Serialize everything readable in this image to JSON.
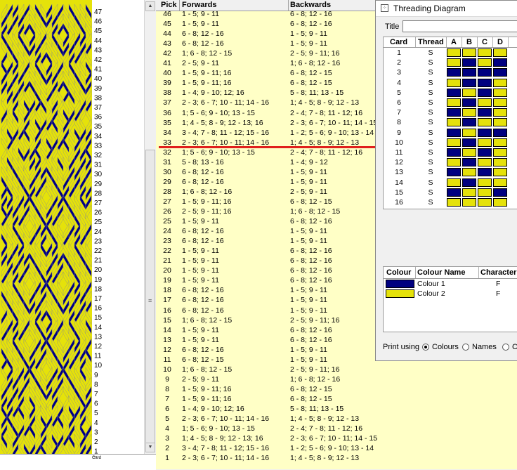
{
  "weave": {
    "colors": {
      "dark": "#000080",
      "light": "#e5e20a",
      "grid": "#8c8c8c"
    },
    "pick_labels": [
      "47",
      "46",
      "45",
      "44",
      "43",
      "42",
      "41",
      "40",
      "39",
      "38",
      "37",
      "36",
      "35",
      "34",
      "33",
      "32",
      "31",
      "30",
      "29",
      "28",
      "27",
      "26",
      "25",
      "24",
      "23",
      "22",
      "21",
      "20",
      "19",
      "18",
      "17",
      "16",
      "15",
      "14",
      "13",
      "12",
      "11",
      "10",
      "9",
      "8",
      "7",
      "6",
      "5",
      "4",
      "3",
      "2",
      "1"
    ],
    "card_label": "Card",
    "card_arrow": "←"
  },
  "scrollbar": {
    "up": "▲",
    "down": "▼",
    "grip": "≡"
  },
  "pick_table": {
    "headers": {
      "pick": "Pick",
      "forwards": "Forwards",
      "backwards": "Backwards"
    },
    "rows": [
      {
        "pick": "46",
        "fwd": "1 - 5; 9 - 11",
        "bwd": "6 - 8; 12 - 16"
      },
      {
        "pick": "45",
        "fwd": "1 - 5; 9 - 11",
        "bwd": "6 - 8; 12 - 16"
      },
      {
        "pick": "44",
        "fwd": "6 - 8; 12 - 16",
        "bwd": "1 - 5; 9 - 11"
      },
      {
        "pick": "43",
        "fwd": "6 - 8; 12 - 16",
        "bwd": "1 - 5; 9 - 11"
      },
      {
        "pick": "42",
        "fwd": "1; 6 - 8; 12 - 15",
        "bwd": "2 - 5; 9 - 11; 16"
      },
      {
        "pick": "41",
        "fwd": "2 - 5; 9 - 11",
        "bwd": "1; 6 - 8; 12 - 16"
      },
      {
        "pick": "40",
        "fwd": "1 - 5; 9 - 11; 16",
        "bwd": "6 - 8; 12 - 15"
      },
      {
        "pick": "39",
        "fwd": "1 - 5; 9 - 11; 16",
        "bwd": "6 - 8; 12 - 15"
      },
      {
        "pick": "38",
        "fwd": "1 - 4; 9 - 10; 12; 16",
        "bwd": "5 - 8; 11; 13 - 15"
      },
      {
        "pick": "37",
        "fwd": "2 - 3; 6 - 7; 10 - 11; 14 - 16",
        "bwd": "1; 4 - 5; 8 - 9; 12 - 13"
      },
      {
        "pick": "36",
        "fwd": "1; 5 - 6; 9 - 10; 13 - 15",
        "bwd": "2 - 4; 7 - 8; 11 - 12; 16"
      },
      {
        "pick": "35",
        "fwd": "1; 4 - 5; 8 - 9; 12 - 13; 16",
        "bwd": "2 - 3; 6 - 7; 10 - 11; 14 - 15"
      },
      {
        "pick": "34",
        "fwd": "3 - 4; 7 - 8; 11 - 12; 15 - 16",
        "bwd": "1 - 2; 5 - 6; 9 - 10; 13 - 14"
      },
      {
        "pick": "33",
        "fwd": "2 - 3; 6 - 7; 10 - 11; 14 - 16",
        "bwd": "1; 4 - 5; 8 - 9; 12 - 13"
      },
      {
        "pick": "32",
        "fwd": "1; 5 - 6; 9 - 10; 13 - 15",
        "bwd": "2 - 4; 7 - 8; 11 - 12; 16"
      },
      {
        "pick": "31",
        "fwd": "5 - 8; 13 - 16",
        "bwd": "1 - 4; 9 - 12"
      },
      {
        "pick": "30",
        "fwd": "6 - 8; 12 - 16",
        "bwd": "1 - 5; 9 - 11"
      },
      {
        "pick": "29",
        "fwd": "6 - 8; 12 - 16",
        "bwd": "1 - 5; 9 - 11"
      },
      {
        "pick": "28",
        "fwd": "1; 6 - 8; 12 - 16",
        "bwd": "2 - 5; 9 - 11"
      },
      {
        "pick": "27",
        "fwd": "1 - 5; 9 - 11; 16",
        "bwd": "6 - 8; 12 - 15"
      },
      {
        "pick": "26",
        "fwd": "2 - 5; 9 - 11; 16",
        "bwd": "1; 6 - 8; 12 - 15"
      },
      {
        "pick": "25",
        "fwd": "1 - 5; 9 - 11",
        "bwd": "6 - 8; 12 - 16"
      },
      {
        "pick": "24",
        "fwd": "6 - 8; 12 - 16",
        "bwd": "1 - 5; 9 - 11"
      },
      {
        "pick": "23",
        "fwd": "6 - 8; 12 - 16",
        "bwd": "1 - 5; 9 - 11"
      },
      {
        "pick": "22",
        "fwd": "1 - 5; 9 - 11",
        "bwd": "6 - 8; 12 - 16"
      },
      {
        "pick": "21",
        "fwd": "1 - 5; 9 - 11",
        "bwd": "6 - 8; 12 - 16"
      },
      {
        "pick": "20",
        "fwd": "1 - 5; 9 - 11",
        "bwd": "6 - 8; 12 - 16"
      },
      {
        "pick": "19",
        "fwd": "1 - 5; 9 - 11",
        "bwd": "6 - 8; 12 - 16"
      },
      {
        "pick": "18",
        "fwd": "6 - 8; 12 - 16",
        "bwd": "1 - 5; 9 - 11"
      },
      {
        "pick": "17",
        "fwd": "6 - 8; 12 - 16",
        "bwd": "1 - 5; 9 - 11"
      },
      {
        "pick": "16",
        "fwd": "6 - 8; 12 - 16",
        "bwd": "1 - 5; 9 - 11"
      },
      {
        "pick": "15",
        "fwd": "1; 6 - 8; 12 - 15",
        "bwd": "2 - 5; 9 - 11; 16"
      },
      {
        "pick": "14",
        "fwd": "1 - 5; 9 - 11",
        "bwd": "6 - 8; 12 - 16"
      },
      {
        "pick": "13",
        "fwd": "1 - 5; 9 - 11",
        "bwd": "6 - 8; 12 - 16"
      },
      {
        "pick": "12",
        "fwd": "6 - 8; 12 - 16",
        "bwd": "1 - 5; 9 - 11"
      },
      {
        "pick": "11",
        "fwd": "6 - 8; 12 - 15",
        "bwd": "1 - 5; 9 - 11"
      },
      {
        "pick": "10",
        "fwd": "1; 6 - 8; 12 - 15",
        "bwd": "2 - 5; 9 - 11; 16"
      },
      {
        "pick": "9",
        "fwd": "2 - 5; 9 - 11",
        "bwd": "1; 6 - 8; 12 - 16"
      },
      {
        "pick": "8",
        "fwd": "1 - 5; 9 - 11; 16",
        "bwd": "6 - 8; 12 - 15"
      },
      {
        "pick": "7",
        "fwd": "1 - 5; 9 - 11; 16",
        "bwd": "6 - 8; 12 - 15"
      },
      {
        "pick": "6",
        "fwd": "1 - 4; 9 - 10; 12; 16",
        "bwd": "5 - 8; 11; 13 - 15"
      },
      {
        "pick": "5",
        "fwd": "2 - 3; 6 - 7; 10 - 11; 14 - 16",
        "bwd": "1; 4 - 5; 8 - 9; 12 - 13"
      },
      {
        "pick": "4",
        "fwd": "1; 5 - 6; 9 - 10; 13 - 15",
        "bwd": "2 - 4; 7 - 8; 11 - 12; 16"
      },
      {
        "pick": "3",
        "fwd": "1; 4 - 5; 8 - 9; 12 - 13; 16",
        "bwd": "2 - 3; 6 - 7; 10 - 11; 14 - 15"
      },
      {
        "pick": "2",
        "fwd": "3 - 4; 7 - 8; 11 - 12; 15 - 16",
        "bwd": "1 - 2; 5 - 6; 9 - 10; 13 - 14"
      },
      {
        "pick": "1",
        "fwd": "2 - 3; 6 - 7; 10 - 11; 14 - 16",
        "bwd": "1; 4 - 5; 8 - 9; 12 - 13"
      }
    ],
    "marker_color": "#e0201c"
  },
  "dialog": {
    "title": "Threading Diagram",
    "title_label": "Title",
    "title_value": "",
    "card_headers": {
      "card": "Card",
      "thread": "Thread",
      "a": "A",
      "b": "B",
      "c": "C",
      "d": "D"
    },
    "cards": [
      {
        "card": "1",
        "thread": "S",
        "holes": [
          "L",
          "L",
          "L",
          "L"
        ]
      },
      {
        "card": "2",
        "thread": "S",
        "holes": [
          "L",
          "D",
          "L",
          "D"
        ]
      },
      {
        "card": "3",
        "thread": "S",
        "holes": [
          "D",
          "D",
          "D",
          "D"
        ]
      },
      {
        "card": "4",
        "thread": "S",
        "holes": [
          "L",
          "D",
          "D",
          "L"
        ]
      },
      {
        "card": "5",
        "thread": "S",
        "holes": [
          "D",
          "L",
          "D",
          "L"
        ]
      },
      {
        "card": "6",
        "thread": "S",
        "holes": [
          "L",
          "D",
          "L",
          "L"
        ]
      },
      {
        "card": "7",
        "thread": "S",
        "holes": [
          "D",
          "L",
          "D",
          "L"
        ]
      },
      {
        "card": "8",
        "thread": "S",
        "holes": [
          "L",
          "D",
          "L",
          "L"
        ]
      },
      {
        "card": "9",
        "thread": "S",
        "holes": [
          "D",
          "L",
          "D",
          "D"
        ]
      },
      {
        "card": "10",
        "thread": "S",
        "holes": [
          "L",
          "D",
          "L",
          "L"
        ]
      },
      {
        "card": "11",
        "thread": "S",
        "holes": [
          "D",
          "L",
          "D",
          "L"
        ]
      },
      {
        "card": "12",
        "thread": "S",
        "holes": [
          "L",
          "D",
          "L",
          "L"
        ]
      },
      {
        "card": "13",
        "thread": "S",
        "holes": [
          "D",
          "L",
          "D",
          "L"
        ]
      },
      {
        "card": "14",
        "thread": "S",
        "holes": [
          "L",
          "D",
          "L",
          "L"
        ]
      },
      {
        "card": "15",
        "thread": "S",
        "holes": [
          "D",
          "L",
          "L",
          "D"
        ]
      },
      {
        "card": "16",
        "thread": "S",
        "holes": [
          "L",
          "L",
          "L",
          "L"
        ]
      }
    ],
    "colour_headers": {
      "colour": "Colour",
      "name": "Colour Name",
      "character": "Character"
    },
    "colours": [
      {
        "name": "Colour 1",
        "character": "F",
        "hex": "#000080"
      },
      {
        "name": "Colour 2",
        "character": "F",
        "hex": "#e5e20a"
      }
    ],
    "print": {
      "label": "Print using",
      "options": [
        "Colours",
        "Names",
        "C"
      ],
      "selected": "Colours"
    }
  }
}
